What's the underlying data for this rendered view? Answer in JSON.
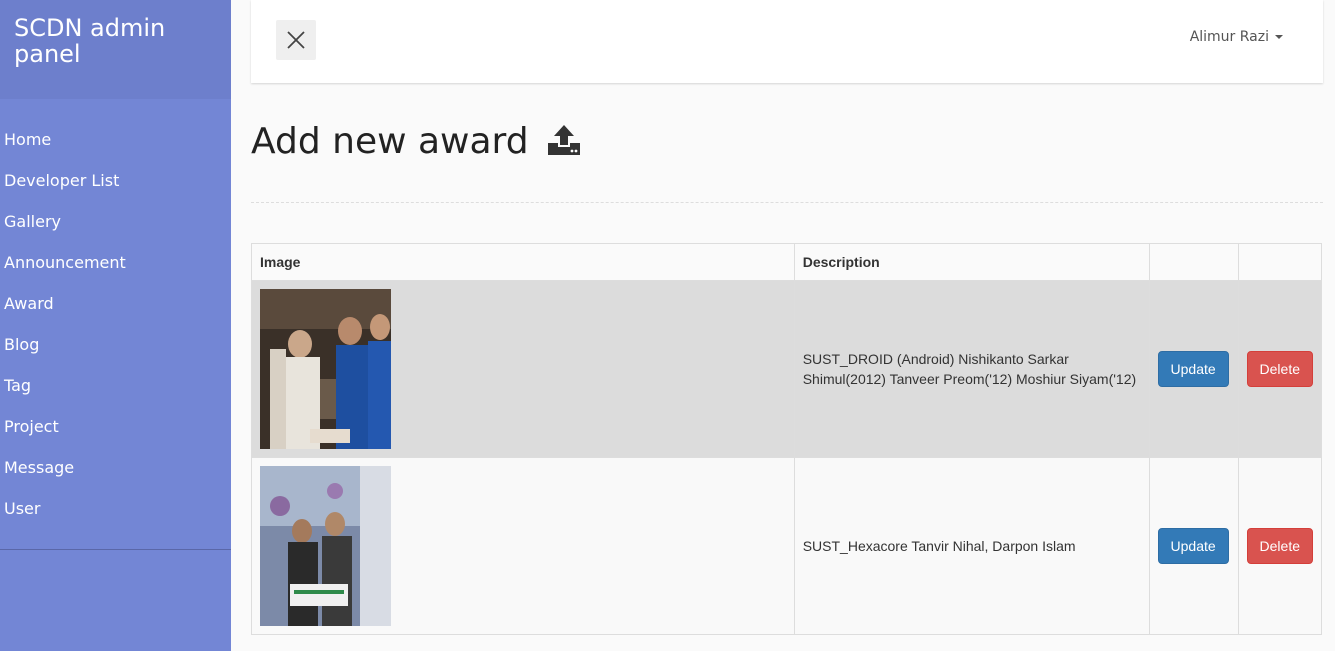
{
  "sidebar": {
    "brand": "SCDN admin panel",
    "items": [
      {
        "label": "Home"
      },
      {
        "label": "Developer List"
      },
      {
        "label": "Gallery"
      },
      {
        "label": "Announcement"
      },
      {
        "label": "Award"
      },
      {
        "label": "Blog"
      },
      {
        "label": "Tag"
      },
      {
        "label": "Project"
      },
      {
        "label": "Message"
      },
      {
        "label": "User"
      }
    ]
  },
  "header": {
    "user_name": "Alimur Razi"
  },
  "main": {
    "title": "Add new award",
    "table": {
      "columns": [
        "Image",
        "Description",
        "",
        ""
      ],
      "rows": [
        {
          "description": "SUST_DROID (Android) Nishikanto Sarkar Shimul(2012) Tanveer Preom('12) Moshiur Siyam('12)",
          "update_label": "Update",
          "delete_label": "Delete"
        },
        {
          "description": "SUST_Hexacore Tanvir Nihal, Darpon Islam",
          "update_label": "Update",
          "delete_label": "Delete"
        }
      ]
    }
  },
  "colors": {
    "sidebar": "#7386d5",
    "brand_bg": "#6d7fcc",
    "update_button": "#337ab7",
    "delete_button": "#d9534f"
  }
}
